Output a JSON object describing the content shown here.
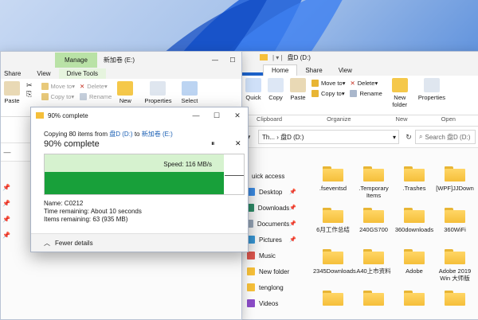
{
  "leftWindow": {
    "titleTab": "Manage",
    "title": "新加卷 (E:)",
    "tabs": [
      "Share",
      "View",
      "Drive Tools"
    ],
    "ribbon": {
      "paste": "Paste",
      "moveTo": "Move to",
      "copyTo": "Copy to",
      "delete": "Delete",
      "rename": "Rename",
      "new": "New",
      "properties": "Properties",
      "select": "Select"
    },
    "sideItems": [
      "",
      "",
      "",
      ""
    ]
  },
  "rightWindow": {
    "title": "盘D (D:)",
    "tabs": [
      "Home",
      "Share",
      "View"
    ],
    "ribbon": {
      "quickAccess": "Quick",
      "copy": "Copy",
      "paste": "Paste",
      "moveTo": "Move to",
      "copyTo": "Copy to",
      "delete": "Delete",
      "rename": "Rename",
      "newFolder": "New folder",
      "properties": "Properties",
      "clipboard": "Clipboard",
      "organize": "Organize",
      "new": "New",
      "open": "Open"
    },
    "breadcrumb": "Th...  ›  盘D (D:)",
    "searchPlaceholder": "Search 盘D (D:)",
    "sidebar": [
      "uick access",
      "Desktop",
      "Downloads",
      "Documents",
      "Pictures",
      "Music",
      "New folder",
      "tenglong",
      "Videos"
    ],
    "files": [
      ".fseventsd",
      ".Temporary Items",
      ".Trashes",
      "[WPF]JJDown",
      "6月工作总结",
      "240GS700",
      "360downloads",
      "360WiFi",
      "2345Downloads",
      "A40上市资料",
      "Adobe",
      "Adobe 2019 Win 大师版",
      "",
      "",
      "",
      ""
    ]
  },
  "dialog": {
    "title": "90% complete",
    "copyingPrefix": "Copying 80 items from ",
    "source": "盘D (D:)",
    "to": " to ",
    "dest": "新加卷 (E:)",
    "headline": "90% complete",
    "speed": "Speed: 116 MB/s",
    "progress": 0.9,
    "name": "Name:  C0212",
    "timeRemaining": "Time remaining:  About 10 seconds",
    "itemsRemaining": "Items remaining:  63 (935 MB)",
    "fewerDetails": "Fewer details",
    "pause": "⏸",
    "cancel": "✕"
  }
}
